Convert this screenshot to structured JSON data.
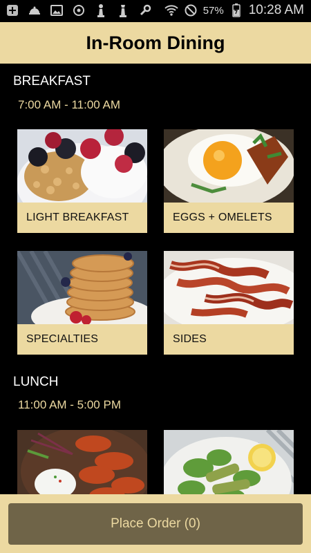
{
  "status_bar": {
    "battery": "57%",
    "time": "10:28 AM"
  },
  "header": {
    "title": "In-Room Dining"
  },
  "sections": [
    {
      "title": "BREAKFAST",
      "hours": "7:00 AM - 11:00 AM",
      "items": [
        {
          "label": "LIGHT BREAKFAST",
          "image": "granola-berries-yogurt-bowl"
        },
        {
          "label": "EGGS + OMELETS",
          "image": "fried-egg-plate"
        },
        {
          "label": "SPECIALTIES",
          "image": "pancake-stack"
        },
        {
          "label": "SIDES",
          "image": "bacon-strips"
        }
      ]
    },
    {
      "title": "LUNCH",
      "hours": "11:00 AM - 5:00 PM",
      "items": [
        {
          "label": "",
          "image": "glazed-wings-with-dip"
        },
        {
          "label": "",
          "image": "salad-plate"
        }
      ]
    }
  ],
  "footer": {
    "button_label": "Place Order (0)"
  },
  "colors": {
    "accent": "#ecd9a1",
    "button": "#6f6448",
    "background": "#000000"
  }
}
